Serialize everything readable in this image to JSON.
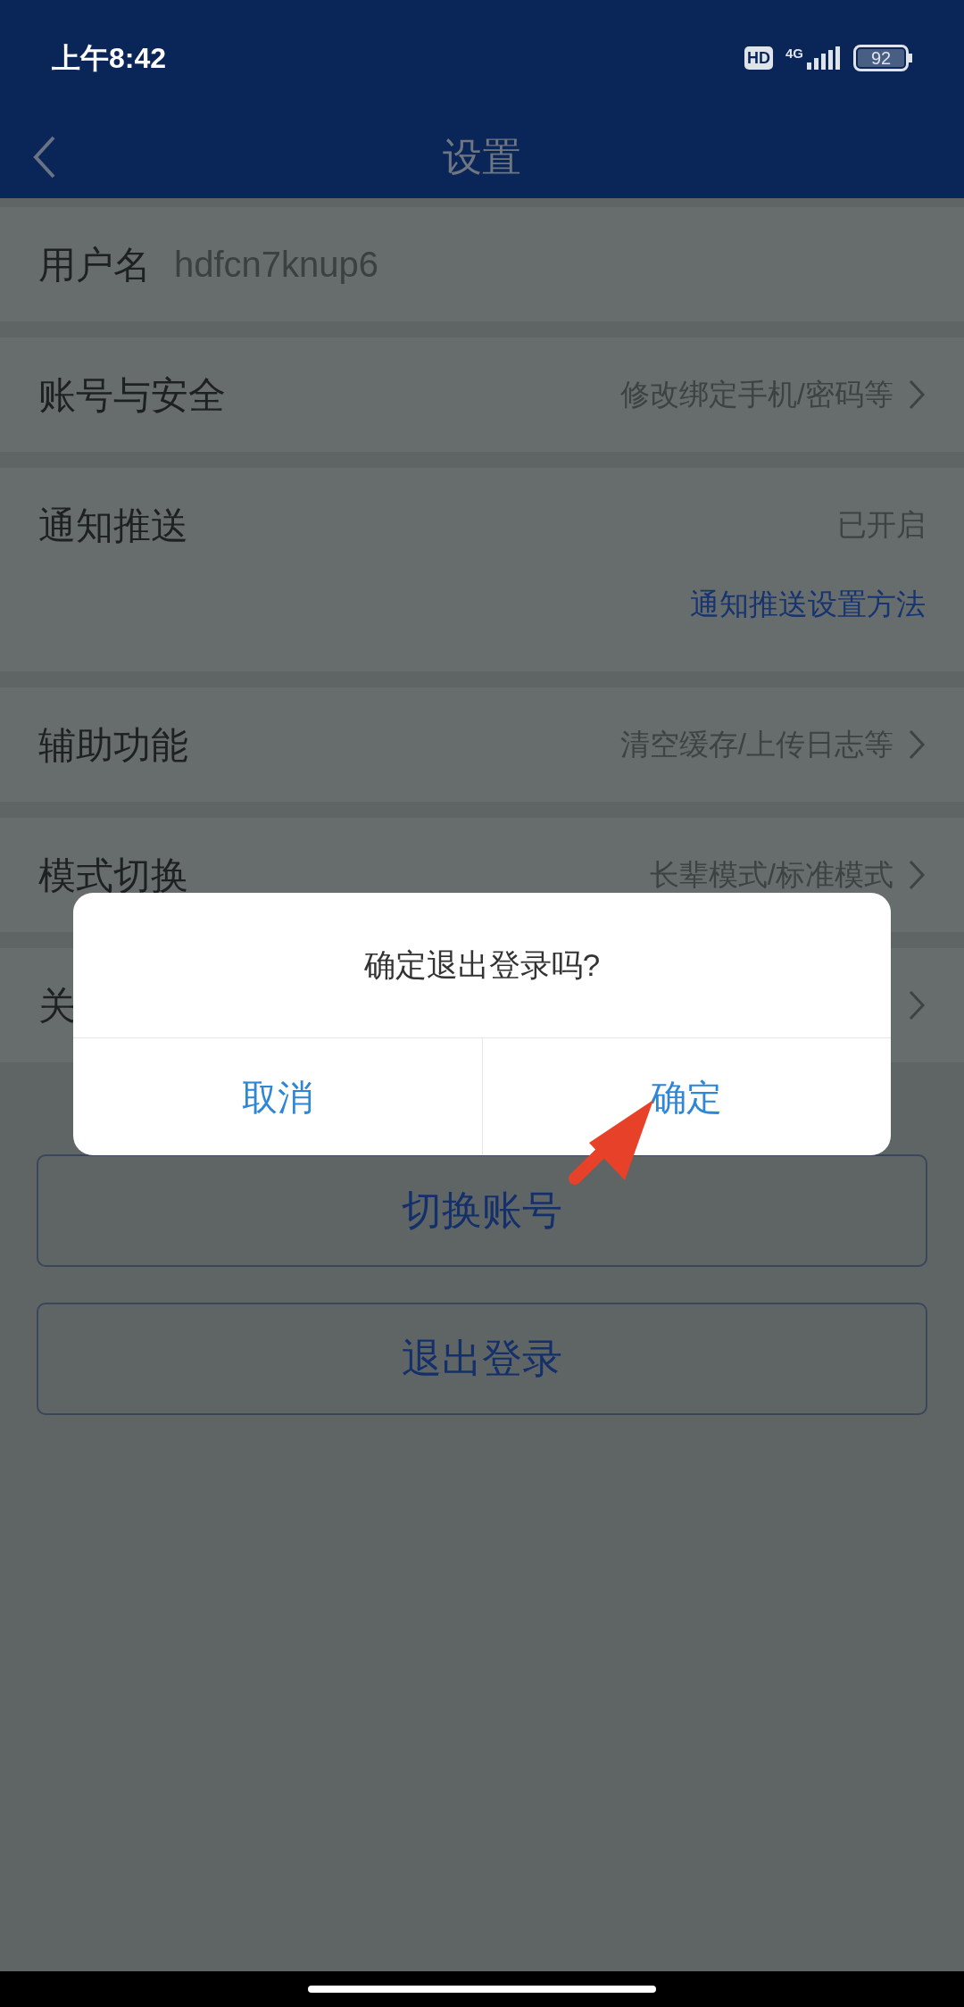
{
  "status_bar": {
    "time": "上午8:42",
    "hd": "HD",
    "network": "4G",
    "battery": "92"
  },
  "nav": {
    "title": "设置"
  },
  "rows": [
    {
      "kind": "field",
      "label": "用户名",
      "value": "hdfcn7knup6"
    },
    {
      "kind": "nav",
      "label": "账号与安全",
      "value": "修改绑定手机/密码等"
    },
    {
      "kind": "status",
      "label": "通知推送",
      "value": "已开启",
      "help": "通知推送设置方法"
    },
    {
      "kind": "nav",
      "label": "辅助功能",
      "value": "清空缓存/上传日志等"
    },
    {
      "kind": "nav",
      "label": "模式切换",
      "value": "长辈模式/标准模式"
    },
    {
      "kind": "nav",
      "label": "关"
    }
  ],
  "buttons": [
    "切换账号",
    "退出登录"
  ],
  "dialog": {
    "title": "确定退出登录吗?",
    "buttons": [
      "取消",
      "确定"
    ]
  }
}
